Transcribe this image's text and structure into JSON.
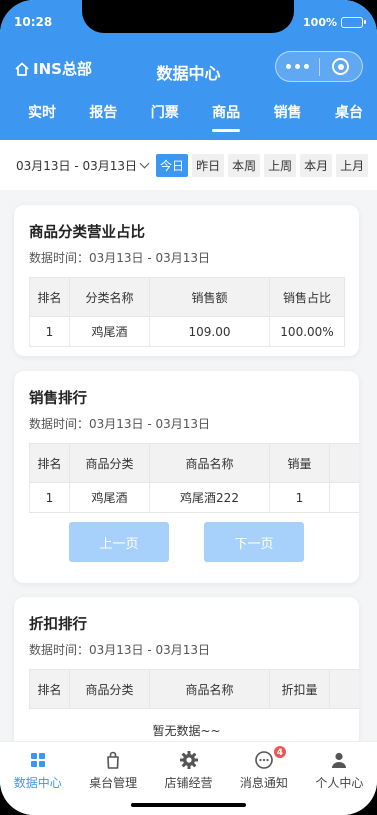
{
  "status_bar": {
    "time": "10:28",
    "battery": "100%",
    "battery_level": 1.0
  },
  "header": {
    "store_name": "INS总部",
    "title": "数据中心",
    "tabs": [
      {
        "label": "实时",
        "active": false
      },
      {
        "label": "报告",
        "active": false
      },
      {
        "label": "门票",
        "active": false
      },
      {
        "label": "商品",
        "active": true
      },
      {
        "label": "销售",
        "active": false
      },
      {
        "label": "桌台",
        "active": false
      }
    ]
  },
  "filters": {
    "date_range": "03月13日 - 03月13日",
    "quick": [
      {
        "label": "今日",
        "active": true
      },
      {
        "label": "昨日",
        "active": false
      },
      {
        "label": "本周",
        "active": false
      },
      {
        "label": "上周",
        "active": false
      },
      {
        "label": "本月",
        "active": false
      },
      {
        "label": "上月",
        "active": false
      }
    ]
  },
  "cards": {
    "category_share": {
      "title": "商品分类营业占比",
      "time": "数据时间：03月13日 - 03月13日",
      "headers": [
        "排名",
        "分类名称",
        "销售额",
        "销售占比"
      ],
      "rows": [
        [
          "1",
          "鸡尾酒",
          "109.00",
          "100.00%"
        ]
      ]
    },
    "sales_rank": {
      "title": "销售排行",
      "time": "数据时间：03月13日 - 03月13日",
      "headers": [
        "排名",
        "商品分类",
        "商品名称",
        "销量"
      ],
      "rows": [
        [
          "1",
          "鸡尾酒",
          "鸡尾酒222",
          "1"
        ]
      ],
      "prev": "上一页",
      "next": "下一页"
    },
    "discount_rank": {
      "title": "折扣排行",
      "time": "数据时间：03月13日 - 03月13日",
      "headers": [
        "排名",
        "商品分类",
        "商品名称",
        "折扣量"
      ],
      "empty": "暂无数据~~"
    }
  },
  "bottom_nav": [
    {
      "label": "数据中心",
      "icon": "grid-icon",
      "active": true
    },
    {
      "label": "桌台管理",
      "icon": "bag-icon",
      "active": false
    },
    {
      "label": "店铺经营",
      "icon": "gear-icon",
      "active": false
    },
    {
      "label": "消息通知",
      "icon": "chat-icon",
      "active": false,
      "badge": "4"
    },
    {
      "label": "个人中心",
      "icon": "person-icon",
      "active": false
    }
  ],
  "colors": {
    "brand": "#3d97f0",
    "pager_disabled": "#a7d0fb",
    "badge": "#f05454"
  }
}
